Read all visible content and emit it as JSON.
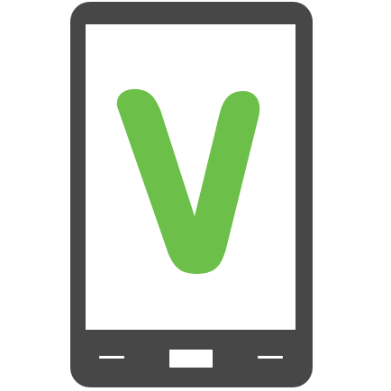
{
  "image": {
    "subject": "phone-with-v-logo-icon",
    "colors": {
      "phone": "#474747",
      "screen": "#ffffff",
      "logo": "#6cc04a",
      "buttons": "#ffffff"
    },
    "icons": {
      "device": "smartphone-icon",
      "logo": "v-letter-icon",
      "back": "dash-icon",
      "home": "home-button-icon",
      "menu": "dash-icon"
    }
  }
}
